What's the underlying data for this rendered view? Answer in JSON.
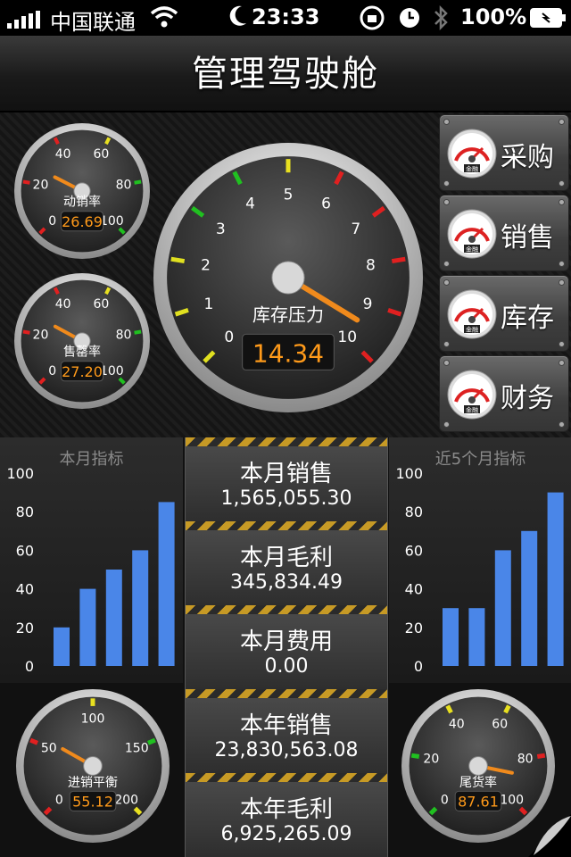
{
  "status_bar": {
    "carrier": "中国联通",
    "time": "23:33",
    "battery": "100%"
  },
  "header": {
    "title": "管理驾驶舱"
  },
  "gauges": {
    "sales_rate": {
      "label": "动销率",
      "value": "26.69",
      "scale": [
        "0",
        "20",
        "40",
        "60",
        "80",
        "100"
      ]
    },
    "sellout_rate": {
      "label": "售罄率",
      "value": "27.20",
      "scale": [
        "0",
        "20",
        "40",
        "60",
        "80",
        "100"
      ]
    },
    "inventory_pressure": {
      "label": "库存压力",
      "value": "14.34",
      "scale": [
        "0",
        "1",
        "2",
        "3",
        "4",
        "5",
        "6",
        "7",
        "8",
        "9",
        "10"
      ]
    },
    "purchase_sales_balance": {
      "label": "进销平衡",
      "value": "55.12",
      "scale": [
        "0",
        "50",
        "100",
        "150",
        "200"
      ]
    },
    "dead_stock_rate": {
      "label": "尾货率",
      "value": "87.61",
      "scale": [
        "0",
        "20",
        "40",
        "60",
        "80",
        "100"
      ]
    }
  },
  "side_buttons": [
    {
      "label": "采购",
      "icon": "mini-gauge-icon",
      "badge": "金融"
    },
    {
      "label": "销售",
      "icon": "mini-gauge-icon",
      "badge": "金融"
    },
    {
      "label": "库存",
      "icon": "mini-gauge-icon",
      "badge": "金融"
    },
    {
      "label": "财务",
      "icon": "mini-gauge-icon",
      "badge": "金融"
    }
  ],
  "chart_data": [
    {
      "type": "bar",
      "title": "本月指标",
      "ylim": [
        0,
        100
      ],
      "yticks": [
        "100",
        "80",
        "60",
        "40",
        "20",
        "0"
      ],
      "values": [
        20,
        40,
        50,
        60,
        85
      ]
    },
    {
      "type": "bar",
      "title": "近5个月指标",
      "ylim": [
        0,
        100
      ],
      "yticks": [
        "100",
        "80",
        "60",
        "40",
        "20",
        "0"
      ],
      "values": [
        30,
        30,
        60,
        70,
        90
      ]
    }
  ],
  "panels": [
    {
      "title": "本月销售",
      "value": "1,565,055.30"
    },
    {
      "title": "本月毛利",
      "value": "345,834.49"
    },
    {
      "title": "本月费用",
      "value": "0.00"
    },
    {
      "title": "本年销售",
      "value": "23,830,563.08"
    },
    {
      "title": "本年毛利",
      "value": "6,925,265.09"
    }
  ],
  "colors": {
    "bar": "#4a86e8",
    "readout": "#ff9a1a",
    "needle": "#f08a1c"
  }
}
